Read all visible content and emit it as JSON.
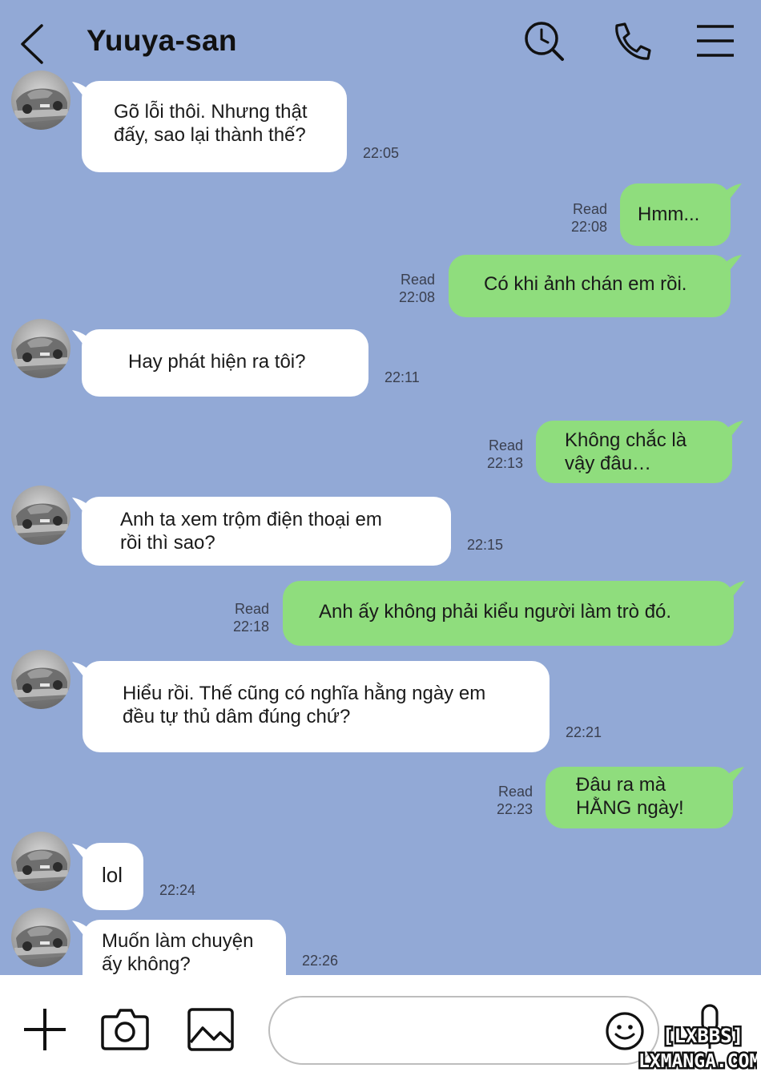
{
  "header": {
    "title": "Yuuya-san",
    "back_icon": "chevron-left-icon",
    "icons": [
      "search-clock-icon",
      "phone-icon",
      "menu-icon"
    ]
  },
  "messages": [
    {
      "side": "in",
      "text": "Gõ lỗi thôi. Nhưng thật\nđấy, sao lại thành thế?",
      "time": "22:05"
    },
    {
      "side": "out",
      "text": "Hmm...",
      "status": "Read",
      "time": "22:08"
    },
    {
      "side": "out",
      "text": "Có khi ảnh chán em rồi.",
      "status": "Read",
      "time": "22:08"
    },
    {
      "side": "in",
      "text": "Hay phát hiện ra tôi?",
      "time": "22:11"
    },
    {
      "side": "out",
      "text": "Không chắc là\nvậy đâu…",
      "status": "Read",
      "time": "22:13"
    },
    {
      "side": "in",
      "text": "Anh ta xem trộm điện thoại em\nrồi thì sao?",
      "time": "22:15"
    },
    {
      "side": "out",
      "text": "Anh ấy không phải kiểu người làm trò đó.",
      "status": "Read",
      "time": "22:18"
    },
    {
      "side": "in",
      "text": "Hiểu rồi. Thế cũng có nghĩa hằng ngày em\nđều tự thủ dâm đúng chứ?",
      "time": "22:21"
    },
    {
      "side": "out",
      "text": "Đâu ra mà\nHẰNG ngày!",
      "status": "Read",
      "time": "22:23"
    },
    {
      "side": "in",
      "text": "lol",
      "time": "22:24"
    },
    {
      "side": "in",
      "text": "Muốn làm chuyện\nấy không?",
      "time": "22:26"
    }
  ],
  "footer": {
    "input_value": "",
    "tools": [
      "plus-icon",
      "camera-icon",
      "image-icon",
      "emoji-icon",
      "microphone-icon"
    ]
  },
  "watermark": {
    "line1": "[LXBBS]",
    "line2": "LXMANGA.COM"
  },
  "colors": {
    "background": "#92a9d6",
    "incoming_bubble": "#ffffff",
    "outgoing_bubble": "#8fdd7d",
    "footer": "#ffffff"
  }
}
